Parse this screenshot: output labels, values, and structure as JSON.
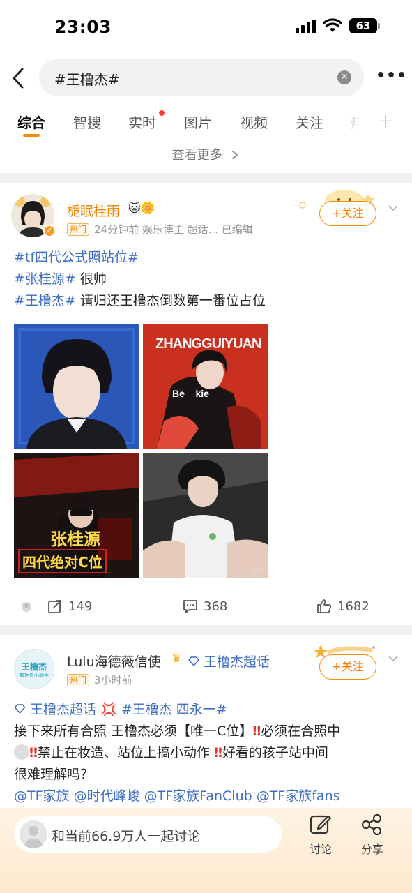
{
  "status_bar": {
    "time": "23:03",
    "battery": "63"
  },
  "search": {
    "query": "#王橹杰#"
  },
  "tabs": [
    {
      "label": "综合"
    },
    {
      "label": "智搜"
    },
    {
      "label": "实时"
    },
    {
      "label": "图片"
    },
    {
      "label": "视频"
    },
    {
      "label": "关注"
    },
    {
      "label": "热"
    }
  ],
  "see_more": "查看更多",
  "posts": [
    {
      "username": "栀眠桂雨",
      "badge": "热门",
      "meta": "24分钟前  娱乐博主 超话...  已编辑",
      "follow_label": "+关注",
      "lines": [
        {
          "tag": "#tf四代公式照站位#",
          "text": ""
        },
        {
          "tag": "#张桂源#",
          "text": " 很帅"
        },
        {
          "tag": "#王橹杰#",
          "text": " 请归还王橹杰倒数第一番位占位"
        }
      ],
      "photo_texts": {
        "photo2_title": "ZHANGGUIYUAN",
        "photo2_sub": "Be    kie",
        "photo3_name": "张桂源",
        "photo3_line": "四代绝对C位",
        "photo4_credit": "@TF"
      },
      "actions": {
        "repost": "149",
        "comment": "368",
        "like": "1682"
      }
    },
    {
      "username": "Lulu海德薇信使",
      "supertopic": "王橹杰超话",
      "avatar_text1": "王橹杰",
      "avatar_text2": "数据追小助手",
      "badge": "热门",
      "meta": "3小时前",
      "follow_label": "+关注",
      "tag_line": {
        "t1": "王橹杰超话",
        "t2": "#王橹杰 四永一#"
      },
      "body": "接下来所有合照 王橹杰必须【唯一C位】‼️必须在合照中间‼️禁止在妆造、站位上搞小动作 ‼️好看的孩子站中间很难理解吗？",
      "body_line1": "接下来所有合照 王橹杰必须【唯一C位】",
      "body_line1b": "必须在合照中",
      "body_line2": "禁止在妆造、站位上搞小动作",
      "body_line2b": "好看的孩子站中间",
      "body_line3": "很难理解吗？",
      "mentions": "@TF家族 @时代峰峻 @TF家族FanClub @TF家族fans"
    }
  ],
  "bottom_bar": {
    "input_text": "和当前66.9万人一起讨论",
    "discuss_label": "讨论",
    "share_label": "分享"
  }
}
